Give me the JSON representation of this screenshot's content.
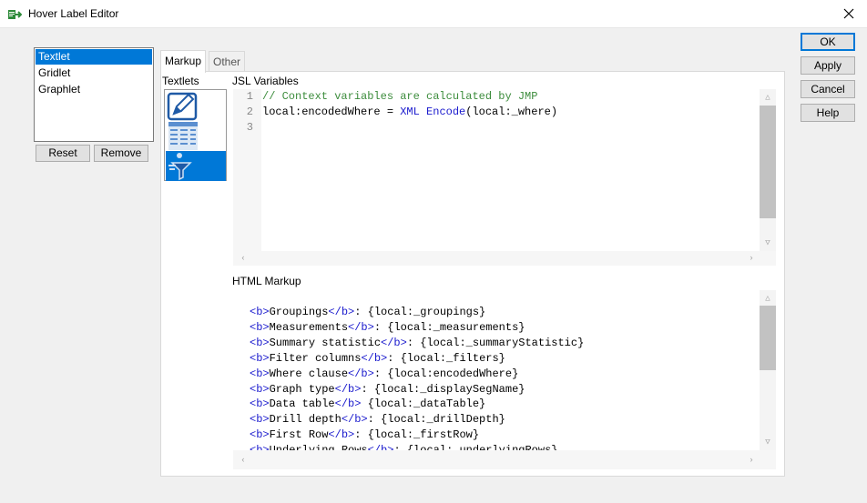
{
  "window": {
    "title": "Hover Label Editor"
  },
  "graphlets": {
    "items": [
      "Textlet",
      "Gridlet",
      "Graphlet"
    ],
    "selected_index": 0,
    "reset_label": "Reset",
    "remove_label": "Remove"
  },
  "tabs": [
    {
      "label": "Markup",
      "active": true
    },
    {
      "label": "Other",
      "active": false
    }
  ],
  "markup": {
    "textlets_label": "Textlets",
    "textlet_icons": [
      "pencil-edit-icon",
      "table-grid-icon",
      "filter-funnel-icon"
    ],
    "jsl_label": "JSL Variables",
    "jsl_lines": [
      {
        "num": "1",
        "text": "// Context variables are calculated by JMP"
      },
      {
        "num": "2",
        "pre": "local:encodedWhere = ",
        "fn": "XML Encode",
        "post": "(local:_where)"
      },
      {
        "num": "3",
        "text": ""
      }
    ],
    "html_label": "HTML Markup",
    "html_lines": [
      {
        "tag": "<b>",
        "name": "Groupings",
        "close": "</b>",
        "rest": ": {local:_groupings}"
      },
      {
        "tag": "<b>",
        "name": "Measurements",
        "close": "</b>",
        "rest": ": {local:_measurements}"
      },
      {
        "tag": "<b>",
        "name": "Summary statistic",
        "close": "</b>",
        "rest": ": {local:_summaryStatistic}"
      },
      {
        "tag": "<b>",
        "name": "Filter columns",
        "close": "</b>",
        "rest": ": {local:_filters}"
      },
      {
        "tag": "<b>",
        "name": "Where clause",
        "close": "</b>",
        "rest": ": {local:encodedWhere}"
      },
      {
        "tag": "<b>",
        "name": "Graph type",
        "close": "</b>",
        "rest": ": {local:_displaySegName}"
      },
      {
        "tag": "<b>",
        "name": "Data table",
        "close": "</b>",
        "rest": " {local:_dataTable}"
      },
      {
        "tag": "<b>",
        "name": "Drill depth",
        "close": "</b>",
        "rest": ": {local:_drillDepth}"
      },
      {
        "tag": "<b>",
        "name": "First Row",
        "close": "</b>",
        "rest": ": {local:_firstRow}"
      },
      {
        "tag": "<b>",
        "name": "Underlying Rows",
        "close": "</b>",
        "rest": ": {local:_underlyingRows}"
      }
    ]
  },
  "actions": {
    "ok": "OK",
    "apply": "Apply",
    "cancel": "Cancel",
    "help": "Help"
  },
  "colors": {
    "selection": "#0078d7",
    "comment": "#3c8c3c",
    "keyword": "#1a1acd"
  }
}
